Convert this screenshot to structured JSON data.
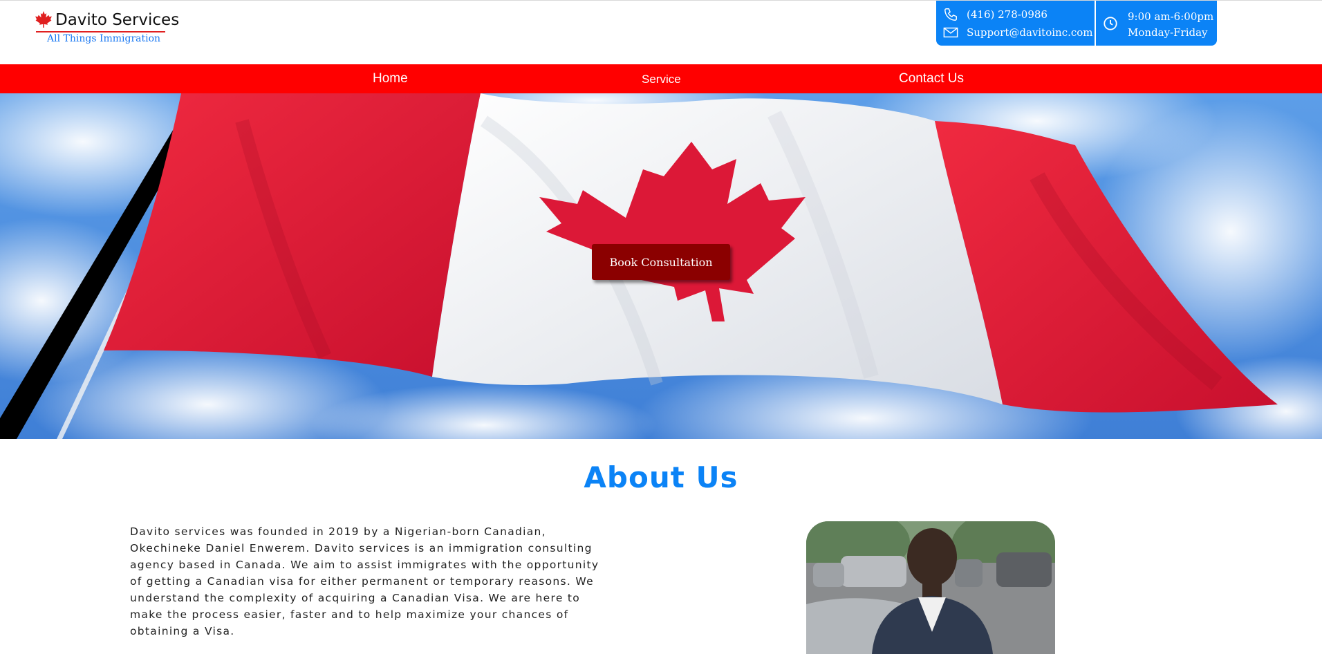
{
  "header": {
    "logo": {
      "title": "Davito Services",
      "tagline": "All Things Immigration",
      "icon": "maple-leaf-icon",
      "icon_color": "#e02020",
      "tagline_color": "#1877f2"
    },
    "contact": {
      "phone": "(416) 278-0986",
      "email": "Support@davitoinc.com",
      "phone_icon": "phone-icon",
      "email_icon": "mail-icon"
    },
    "hours": {
      "time": "9:00 am-6:00pm",
      "days": "Monday-Friday",
      "icon": "clock-icon"
    },
    "box_color": "#0b83f6"
  },
  "nav": {
    "background": "#ff0000",
    "items": [
      {
        "label": "Home"
      },
      {
        "label": "Service"
      },
      {
        "label": "Contact Us"
      }
    ]
  },
  "hero": {
    "image": "canadian-flag-waving-against-sky",
    "cta_label": "Book Consultation",
    "cta_color": "#8b0000"
  },
  "about": {
    "title": "About Us",
    "title_color": "#0b83f6",
    "body": "Davito services was founded in 2019 by a Nigerian-born Canadian, Okechineke Daniel Enwerem. Davito services is an immigration consulting agency based in Canada. We aim to assist immigrates with the opportunity of getting a Canadian visa for either permanent or temporary reasons. We understand the complexity of acquiring a Canadian Visa. We are here to make the process easier, faster and to help maximize your chances of obtaining a Visa.",
    "photo": "founder-portrait"
  }
}
